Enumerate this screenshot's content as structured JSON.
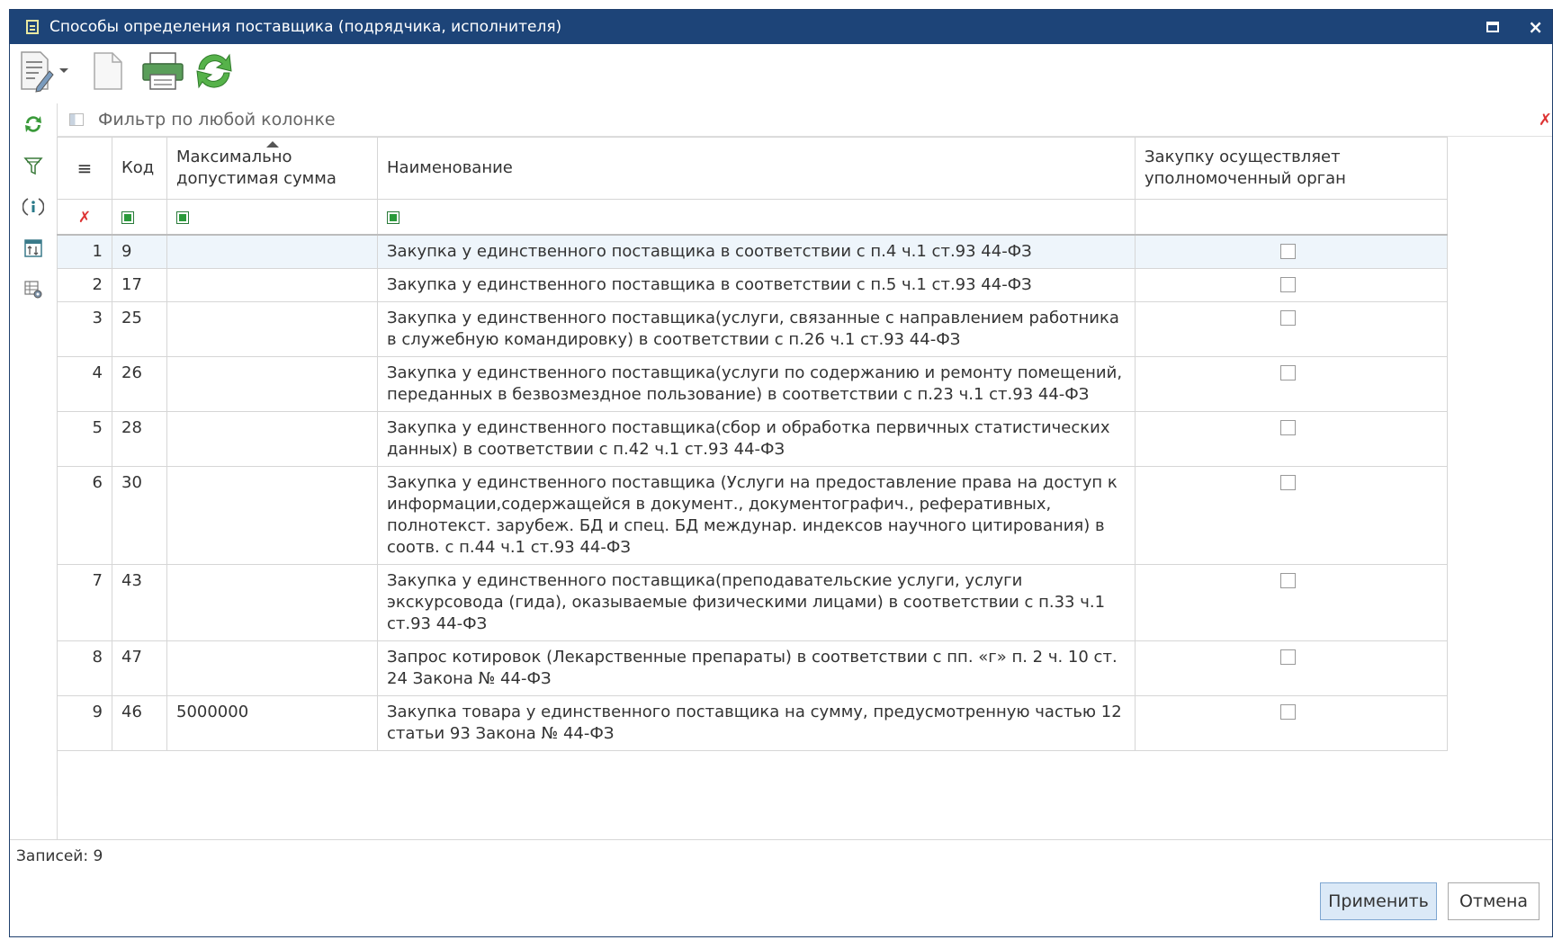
{
  "window": {
    "title": "Способы определения поставщика (подрядчика, исполнителя)",
    "close_glyph": "×"
  },
  "filter": {
    "placeholder": "Фильтр по любой колонке"
  },
  "table": {
    "headers": {
      "menu": "≡",
      "code": "Код",
      "max_sum": "Максимально допустимая сумма",
      "name": "Наименование",
      "authorized": "Закупку осуществляет уполномоченный орган"
    },
    "rows": [
      {
        "n": "1",
        "code": "9",
        "sum": "",
        "name": "Закупка у единственного поставщика в соответствии с п.4 ч.1 ст.93 44-ФЗ",
        "checked": false
      },
      {
        "n": "2",
        "code": "17",
        "sum": "",
        "name": "Закупка у единственного поставщика в соответствии с п.5 ч.1 ст.93 44-ФЗ",
        "checked": false
      },
      {
        "n": "3",
        "code": "25",
        "sum": "",
        "name": "Закупка у единственного поставщика(услуги, связанные с направлением работника в служебную командировку) в соответствии с п.26 ч.1 ст.93 44-ФЗ",
        "checked": false
      },
      {
        "n": "4",
        "code": "26",
        "sum": "",
        "name": "Закупка у единственного поставщика(услуги по содержанию и ремонту помещений, переданных в безвозмездное пользование) в соответствии с п.23 ч.1 ст.93 44-ФЗ",
        "checked": false
      },
      {
        "n": "5",
        "code": "28",
        "sum": "",
        "name": "Закупка у единственного поставщика(сбор и обработка первичных статистических данных) в соответствии с п.42 ч.1 ст.93 44-ФЗ",
        "checked": false
      },
      {
        "n": "6",
        "code": "30",
        "sum": "",
        "name": "Закупка у единственного поставщика (Услуги на предоставление права на доступ к информации,содержащейся в документ., документографич., реферативных, полнотекст. зарубеж. БД и спец. БД междунар. индексов научного цитирования) в соотв. с п.44 ч.1 ст.93 44-ФЗ",
        "checked": false
      },
      {
        "n": "7",
        "code": "43",
        "sum": "",
        "name": "Закупка у единственного поставщика(преподавательские услуги, услуги экскурсовода (гида), оказываемые физическими лицами) в соответствии с п.33 ч.1 ст.93 44-ФЗ",
        "checked": false
      },
      {
        "n": "8",
        "code": "47",
        "sum": "",
        "name": "Запрос котировок (Лекарственные препараты) в соответствии с пп. «г» п. 2 ч. 10 ст. 24 Закона № 44-ФЗ",
        "checked": false
      },
      {
        "n": "9",
        "code": "46",
        "sum": "5000000",
        "name": "Закупка товара у единственного поставщика на сумму, предусмотренную частью 12 статьи 93 Закона № 44-ФЗ",
        "checked": false
      }
    ]
  },
  "status": {
    "records": "Записей: 9"
  },
  "buttons": {
    "apply": "Применить",
    "cancel": "Отмена"
  }
}
